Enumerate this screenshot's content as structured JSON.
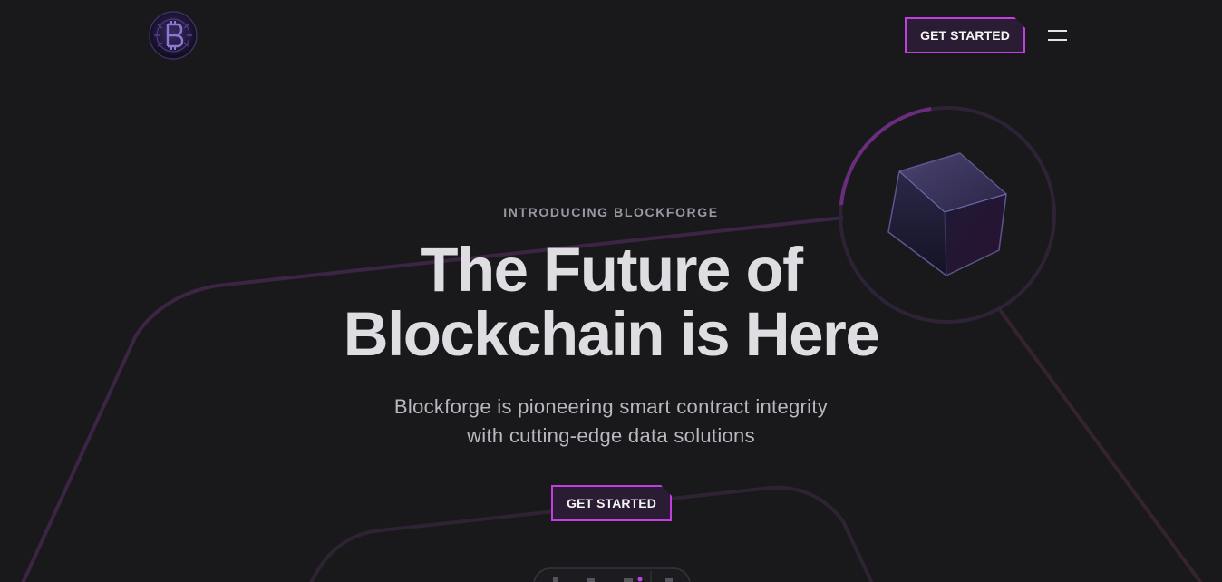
{
  "header": {
    "logo_icon": "blockforge-bitcoin-logo-icon",
    "cta_label": "GET STARTED",
    "menu_icon": "hamburger-menu-icon"
  },
  "hero": {
    "eyebrow": "INTRODUCING BLOCKFORGE",
    "headline_line1": "The Future of",
    "headline_line2": "Blockchain is Here",
    "subtitle_line1": "Blockforge is pioneering smart contract integrity",
    "subtitle_line2": "with cutting-edge data solutions",
    "cta_label": "GET STARTED",
    "cube_icon": "3d-cube-icon"
  },
  "colors": {
    "background": "#19191c",
    "accent": "#c23ee0",
    "accent_line": "#3f2548",
    "headline": "#dedde2",
    "eyebrow": "#9a98a3"
  }
}
